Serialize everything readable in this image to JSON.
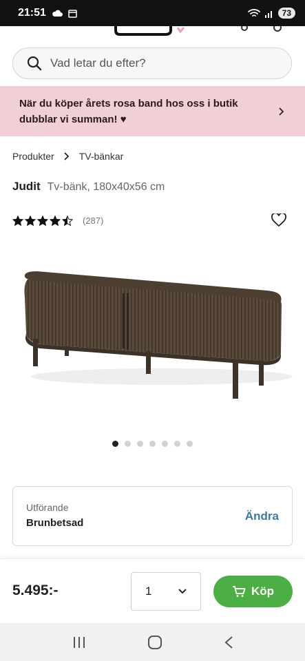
{
  "status_bar": {
    "time": "21:51",
    "battery": "73"
  },
  "search": {
    "placeholder": "Vad letar du efter?"
  },
  "banner": {
    "text": "När du köper årets rosa band hos oss i butik dubblar vi summan! ♥"
  },
  "breadcrumb": {
    "items": [
      "Produkter",
      "TV-bänkar"
    ]
  },
  "product": {
    "name": "Judit",
    "subtitle": "Tv-bänk, 180x40x56 cm",
    "rating": 4.5,
    "review_count": "(287)"
  },
  "gallery": {
    "image_count": 7,
    "active_index": 0
  },
  "variant": {
    "label": "Utförande",
    "value": "Brunbetsad",
    "change_label": "Ändra"
  },
  "purchase": {
    "price": "5.495:-",
    "quantity": "1",
    "buy_label": "Köp"
  },
  "colors": {
    "banner_bg": "#f1cfd6",
    "buy_button": "#4caf45",
    "link": "#3a7aa8"
  }
}
